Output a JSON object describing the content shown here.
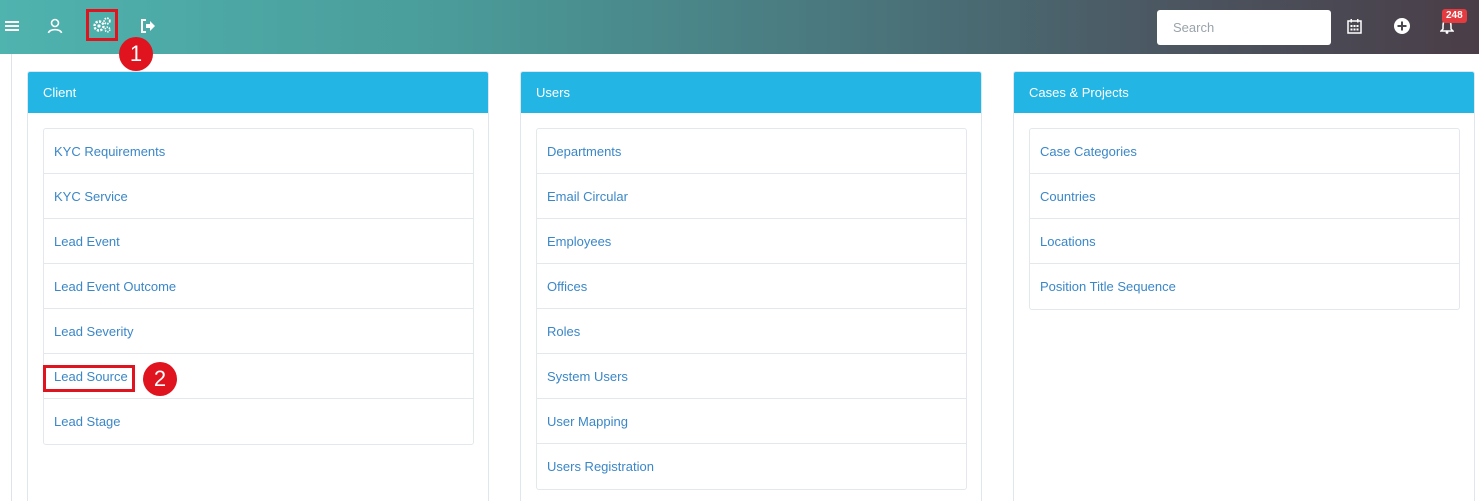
{
  "topbar": {
    "search_placeholder": "Search",
    "notification_count": "248",
    "colors": {
      "gradient_start": "#4fb3ae",
      "gradient_end": "#4a3d47",
      "badge": "#e33b3f"
    }
  },
  "markers": {
    "step1": "1",
    "step2": "2"
  },
  "panels": {
    "client": {
      "title": "Client",
      "items": [
        "KYC Requirements",
        "KYC Service",
        "Lead Event",
        "Lead Event Outcome",
        "Lead Severity",
        "Lead Source",
        "Lead Stage"
      ]
    },
    "users": {
      "title": "Users",
      "items": [
        "Departments",
        "Email Circular",
        "Employees",
        "Offices",
        "Roles",
        "System Users",
        "User Mapping",
        "Users Registration"
      ]
    },
    "cases": {
      "title": "Cases & Projects",
      "items": [
        "Case Categories",
        "Countries",
        "Locations",
        "Position Title Sequence"
      ]
    }
  },
  "colors": {
    "panel_header": "#23b6e4",
    "link": "#3a87c8",
    "annotation": "#e0141e"
  }
}
